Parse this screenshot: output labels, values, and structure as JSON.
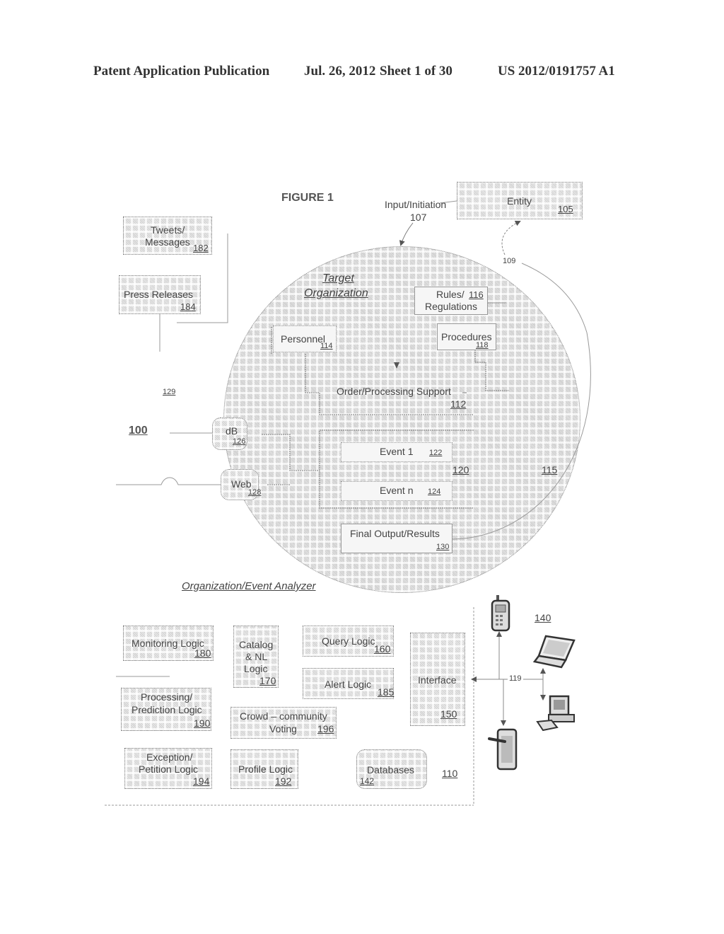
{
  "header": {
    "left": "Patent Application Publication",
    "date": "Jul. 26, 2012",
    "sheet": "Sheet 1 of 30",
    "number": "US 2012/0191757 A1"
  },
  "figure": {
    "title": "FIGURE 1",
    "system_ref": "100",
    "input": {
      "label": "Input/Initiation",
      "ref": "107"
    },
    "entity": {
      "label": "Entity",
      "ref": "105"
    },
    "feedback_ref": "109",
    "target_org": {
      "label_line1": "Target",
      "label_line2": "Organization",
      "ref": "115"
    },
    "rules": {
      "label_line1": "Rules/",
      "label_line2": "Regulations",
      "ref": "116"
    },
    "personnel": {
      "label": "Personnel",
      "ref": "114"
    },
    "procedures": {
      "label": "Procedures",
      "ref": "118"
    },
    "order_support": {
      "label": "Order/Processing Support",
      "ref": "112"
    },
    "events_group_ref": "120",
    "event1": {
      "label": "Event 1",
      "ref": "122"
    },
    "eventn": {
      "label": "Event n",
      "ref": "124"
    },
    "final_output": {
      "label": "Final Output/Results",
      "ref": "130"
    },
    "db": {
      "label": "dB",
      "ref": "126"
    },
    "web": {
      "label": "Web",
      "ref": "128"
    },
    "tweets": {
      "label_line1": "Tweets/",
      "label_line2": "Messages",
      "ref": "182"
    },
    "press": {
      "label": "Press Releases",
      "ref": "184"
    },
    "link_ref": "129",
    "analyzer": {
      "title": "Organization/Event Analyzer",
      "ref": "110",
      "monitoring": {
        "label": "Monitoring Logic",
        "ref": "180"
      },
      "catalog": {
        "label_line1": "Catalog",
        "label_line2": "& NL",
        "label_line3": "Logic",
        "ref": "170"
      },
      "query": {
        "label": "Query Logic",
        "ref": "160"
      },
      "alert": {
        "label": "Alert Logic",
        "ref": "185"
      },
      "processing": {
        "label_line1": "Processing/",
        "label_line2": "Prediction Logic",
        "ref": "190"
      },
      "crowd": {
        "label_line1": "Crowd – community",
        "label_line2": "Voting",
        "ref": "196"
      },
      "exception": {
        "label_line1": "Exception/",
        "label_line2": "Petition Logic",
        "ref": "194"
      },
      "profile": {
        "label": "Profile Logic",
        "ref": "192"
      },
      "databases": {
        "label": "Databases",
        "ref": "142"
      },
      "interface": {
        "label": "Interface",
        "ref": "150"
      }
    },
    "network_ref": "119",
    "devices_ref": "140",
    "device_icons": [
      "cell-phone-icon",
      "laptop-icon",
      "desktop-computer-icon",
      "tablet-pda-icon"
    ]
  }
}
